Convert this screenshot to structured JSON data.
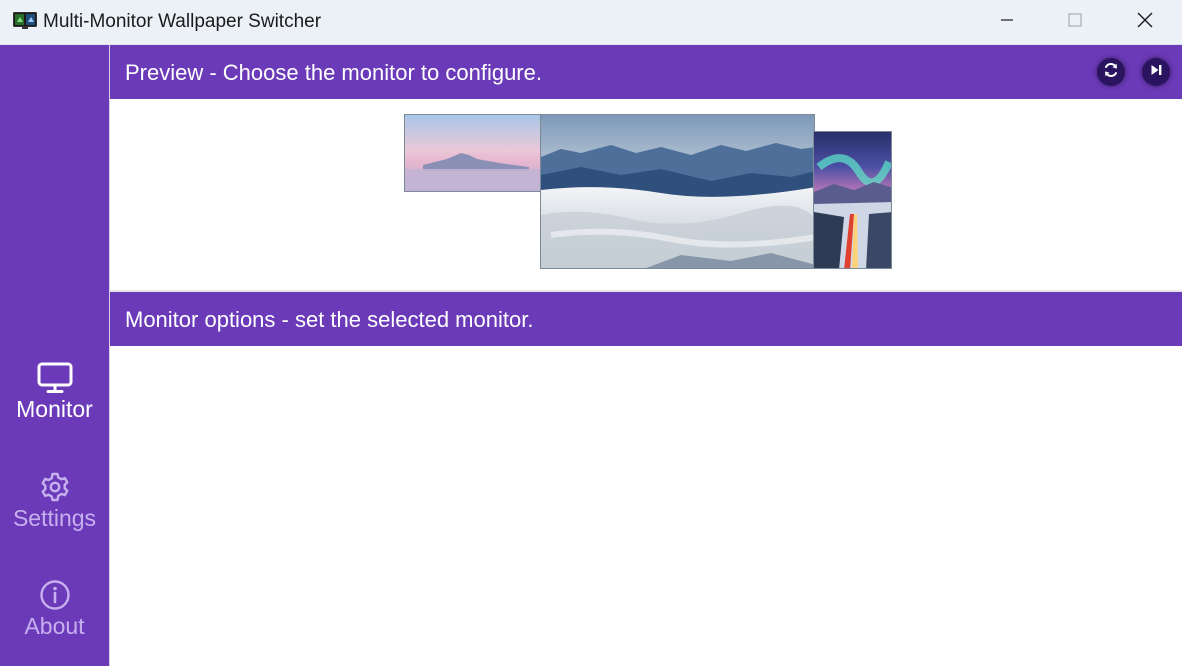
{
  "window": {
    "title": "Multi-Monitor Wallpaper Switcher",
    "controls": {
      "minimize": "minimize-icon",
      "maximize": "maximize-icon",
      "close": "close-icon"
    }
  },
  "sidebar": {
    "items": [
      {
        "label": "Monitor",
        "icon": "monitor-icon",
        "active": true
      },
      {
        "label": "Settings",
        "icon": "gear-icon",
        "active": false
      },
      {
        "label": "About",
        "icon": "info-icon",
        "active": false
      }
    ]
  },
  "preview": {
    "header": "Preview - Choose the monitor to configure.",
    "actions": {
      "refresh": "refresh-icon",
      "next": "skip-next-icon"
    },
    "monitors": [
      {
        "name": "monitor-1",
        "wallpaper": "pink-sky-mountain"
      },
      {
        "name": "monitor-2",
        "wallpaper": "mountains-above-clouds"
      },
      {
        "name": "monitor-3",
        "wallpaper": "aurora-snowy-road"
      }
    ]
  },
  "options": {
    "header": "Monitor options - set the selected monitor."
  },
  "colors": {
    "accent": "#6b3ab9",
    "titlebar": "#ecf1f8",
    "inactive_label": "#c7b0ee"
  }
}
